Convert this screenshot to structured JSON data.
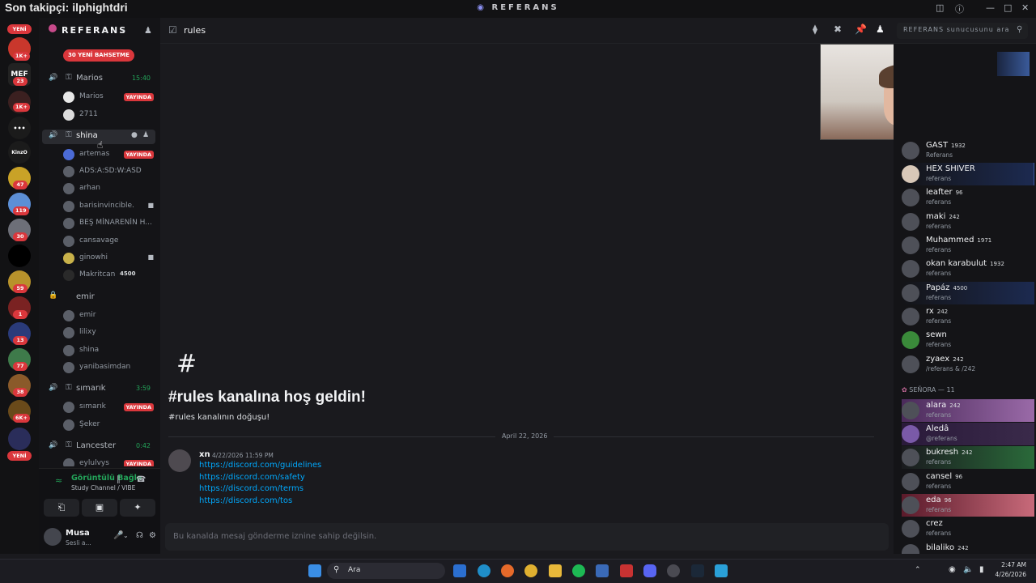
{
  "overlay": {
    "follower_text": "Son takipçi: ilphightdri"
  },
  "window": {
    "title": "REFERANS"
  },
  "colors": {
    "accent": "#5865f2",
    "live": "#da373c",
    "online": "#23a55a",
    "link": "#00a8fc"
  },
  "guilds": {
    "new_top": "YENİ",
    "badges": [
      "1K+",
      "23",
      "1K+",
      "47",
      "119",
      "30",
      "59",
      "1",
      "13",
      "77",
      "38",
      "6K+"
    ],
    "new_bottom": "YENİ",
    "mef_label": "MEF",
    "kinzo_label": "KinzO"
  },
  "server": {
    "name": "REFERANS",
    "mentions_pill": "30 YENİ BAHSETME"
  },
  "voice_channels": [
    {
      "name": "Marios",
      "time": "15:40",
      "members": [
        {
          "name": "Marios",
          "live": "YAYINDA"
        },
        {
          "name": "2711"
        }
      ]
    },
    {
      "name": "shina",
      "members": [
        {
          "name": "artemas",
          "live": "YAYINDA"
        },
        {
          "name": "ADS:A:SD:W:ASD"
        },
        {
          "name": "arhan"
        },
        {
          "name": "barisinvincible."
        },
        {
          "name": "BEŞ MİNARENİN H..."
        },
        {
          "name": "cansavage"
        },
        {
          "name": "ginowhi"
        },
        {
          "name": "Makritcan",
          "tag": "4500"
        }
      ]
    },
    {
      "name": "emir",
      "members": [
        {
          "name": "emir"
        },
        {
          "name": "lilixy"
        },
        {
          "name": "shina"
        },
        {
          "name": "yanibasimdan"
        }
      ]
    },
    {
      "name": "sımarık",
      "time": "3:59",
      "members": [
        {
          "name": "sımarık",
          "live": "YAYINDA"
        },
        {
          "name": "Şeker"
        }
      ]
    },
    {
      "name": "Lancester",
      "time": "0:42",
      "members": [
        {
          "name": "eylulvys",
          "live": "YAYINDA"
        }
      ]
    }
  ],
  "voice_panel": {
    "status": "Görüntülü Bağlantı K",
    "channel": "Study Channel / VIBE"
  },
  "user_panel": {
    "name": "Musa",
    "status": "Sesli a..."
  },
  "channel": {
    "name": "rules",
    "welcome": "#rules kanalına hoş geldin!",
    "subtitle": "#rules kanalının doğuşu!",
    "hash": "#"
  },
  "search": {
    "placeholder": "REFERANS sunucusunu ara"
  },
  "date_divider": "April 22, 2026",
  "message": {
    "author": "xn",
    "timestamp": "4/22/2026 11:59 PM",
    "links": [
      "https://discord.com/guidelines",
      "https://discord.com/safety",
      "https://discord.com/terms",
      "https://discord.com/tos"
    ]
  },
  "composer": {
    "placeholder": "Bu kanalda mesaj gönderme iznine sahip değilsin."
  },
  "members": [
    {
      "name": "GAST",
      "tag": "1932",
      "status": "Referans"
    },
    {
      "name": "HEX SHIVER",
      "tag": "",
      "status": "referans"
    },
    {
      "name": "leafter",
      "tag": "96",
      "status": "referans"
    },
    {
      "name": "maki",
      "tag": "242",
      "status": "referans"
    },
    {
      "name": "Muhammed",
      "tag": "1971",
      "status": "referans"
    },
    {
      "name": "okan karabulut",
      "tag": "1932",
      "status": "referans"
    },
    {
      "name": "Papáz",
      "tag": "4500",
      "status": "referans"
    },
    {
      "name": "rx",
      "tag": "242",
      "status": "referans"
    },
    {
      "name": "sewn",
      "tag": "",
      "status": "referans"
    },
    {
      "name": "zyaex",
      "tag": "242",
      "status": "/referans & /242"
    }
  ],
  "role_group": {
    "name": "SEÑORA — 11"
  },
  "members2": [
    {
      "name": "alara",
      "tag": "242",
      "status": "referans"
    },
    {
      "name": "Aledâ",
      "tag": "",
      "status": "@referans"
    },
    {
      "name": "bukresh",
      "tag": "242",
      "status": "referans"
    },
    {
      "name": "cansel",
      "tag": "96",
      "status": "referans"
    },
    {
      "name": "eda",
      "tag": "96",
      "status": "referans"
    },
    {
      "name": "crez",
      "tag": "",
      "status": "referans"
    },
    {
      "name": "bilaliko",
      "tag": "242",
      "status": ""
    }
  ],
  "taskbar": {
    "search": "Ara",
    "time": "2:47 AM",
    "date": "4/26/2026"
  }
}
